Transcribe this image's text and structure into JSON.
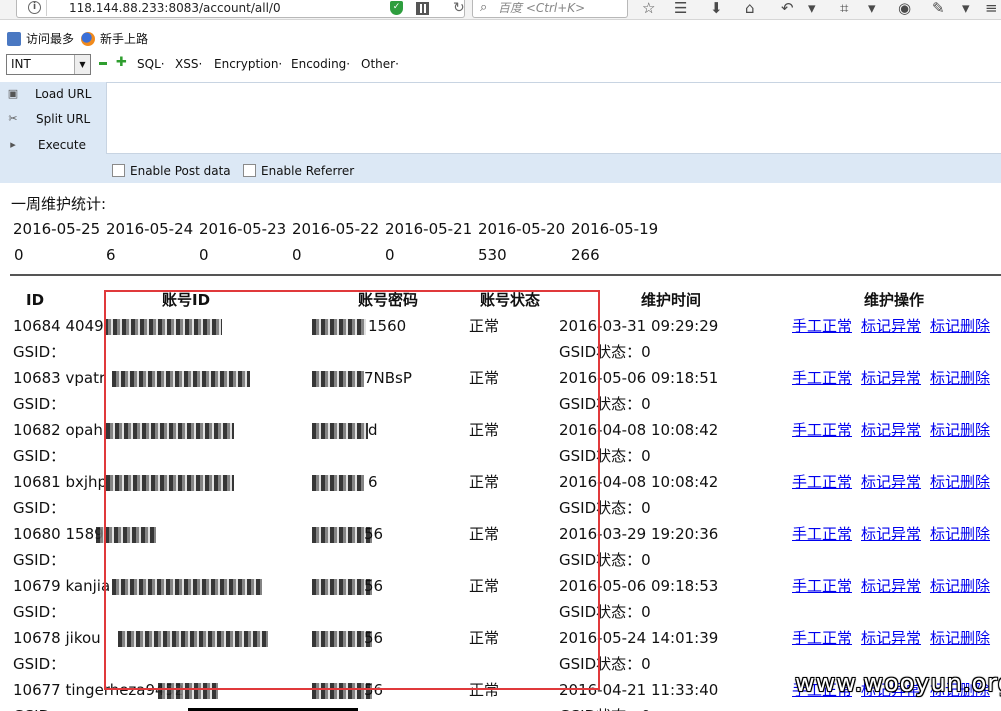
{
  "browser": {
    "url": "118.144.88.233:8083/account/all/0",
    "search_placeholder": "百度 <Ctrl+K>"
  },
  "bookmarks": [
    {
      "label": "访问最多"
    },
    {
      "label": "新手上路"
    }
  ],
  "hackbar": {
    "select_value": "INT",
    "menus": [
      "SQL·",
      "XSS·",
      "Encryption·",
      "Encoding·",
      "Other·"
    ],
    "side": [
      {
        "label": "Load URL"
      },
      {
        "label": "Split URL"
      },
      {
        "label": "Execute"
      }
    ],
    "checks": [
      {
        "label": "Enable Post data"
      },
      {
        "label": "Enable Referrer"
      }
    ]
  },
  "stats": {
    "title": "一周维护统计:",
    "dates": [
      "2016-05-25",
      "2016-05-24",
      "2016-05-23",
      "2016-05-22",
      "2016-05-21",
      "2016-05-20",
      "2016-05-19"
    ],
    "counts": [
      "0",
      "6",
      "0",
      "0",
      "0",
      "530",
      "266"
    ]
  },
  "table": {
    "headers": [
      "ID",
      "账号ID",
      "账号密码",
      "账号状态",
      "维护时间",
      "维护操作"
    ],
    "rows": [
      {
        "id_prefix": "10684 4049",
        "pwd_suffix": "1560",
        "status": "正常",
        "time": "2016-03-31 09:29:29"
      },
      {
        "id_prefix": "10683 vpatr",
        "pwd_suffix": "7NBsP",
        "status": "正常",
        "time": "2016-05-06 09:18:51"
      },
      {
        "id_prefix": "10682 opah",
        "pwd_suffix": "d",
        "status": "正常",
        "time": "2016-04-08 10:08:42"
      },
      {
        "id_prefix": "10681 bxjhp",
        "pwd_suffix": "6",
        "status": "正常",
        "time": "2016-04-08 10:08:42"
      },
      {
        "id_prefix": "10680 1589",
        "pwd_suffix": "56",
        "status": "正常",
        "time": "2016-03-29 19:20:36"
      },
      {
        "id_prefix": "10679 kanjia",
        "pwd_suffix": "56",
        "status": "正常",
        "time": "2016-05-06 09:18:53"
      },
      {
        "id_prefix": "10678 jikou",
        "pwd_suffix": "56",
        "status": "正常",
        "time": "2016-05-24 14:01:39"
      },
      {
        "id_prefix": "10677 tingerheza9452",
        "pwd_suffix": "56",
        "status": "正常",
        "time": "2016-04-21 11:33:40"
      }
    ],
    "gsid_label": "GSID：",
    "gsid_status_label": "GSID状态：0",
    "actions": [
      "手工正常",
      "标记异常",
      "标记删除"
    ]
  },
  "watermark": "www.wooyun.org"
}
